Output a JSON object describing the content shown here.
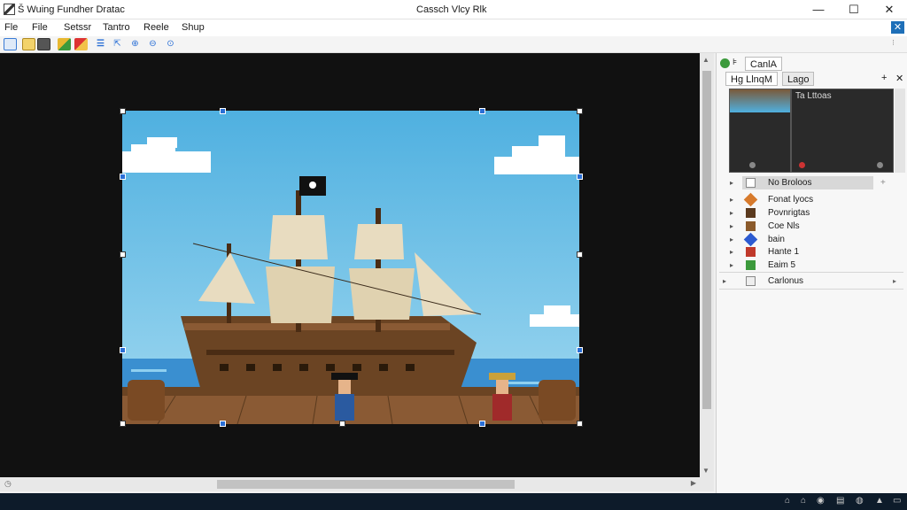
{
  "window": {
    "app_title": "Š Wuing Fundher Dratac",
    "doc_title": "Cassch Vlcy Rlk",
    "min": "—",
    "max": "☐",
    "close": "✕"
  },
  "menu": {
    "items": [
      "Fle",
      "File",
      "Setssr",
      "Tantro",
      "Reele",
      "Shup"
    ]
  },
  "toolbar": {
    "icons": [
      "new-icon",
      "open-icon",
      "save-icon",
      "layers-icon",
      "paint-icon",
      "select-icon",
      "scale-icon",
      "zoom-in-icon",
      "zoom-out-icon",
      "zoom-fit-icon"
    ]
  },
  "right_panel": {
    "tab_main": "CanlA",
    "tab_a": "Hg LlnqM",
    "tab_b": "Lago",
    "preview_label": "Ta Lttoas",
    "selected_item": "No Broloos",
    "items": [
      {
        "label": "Fonat lyocs",
        "color": "#d77a2c"
      },
      {
        "label": "Povnrigtas",
        "color": "#5b3a1e"
      },
      {
        "label": "Coe Nls",
        "color": "#8b5a2b"
      },
      {
        "label": "bain",
        "color": "#2d5bd1"
      },
      {
        "label": "Hante 1",
        "color": "#c0392b"
      },
      {
        "label": "Eaim 5",
        "color": "#3c9a3c"
      },
      {
        "label": "Carlonus",
        "color": "#888888"
      }
    ]
  },
  "colors": {
    "accent": "#1e6fb8",
    "taskbar": "#0d1b2a",
    "sky": "#5cb8e4",
    "sea": "#3a8fd0",
    "deck": "#8a5a34"
  }
}
